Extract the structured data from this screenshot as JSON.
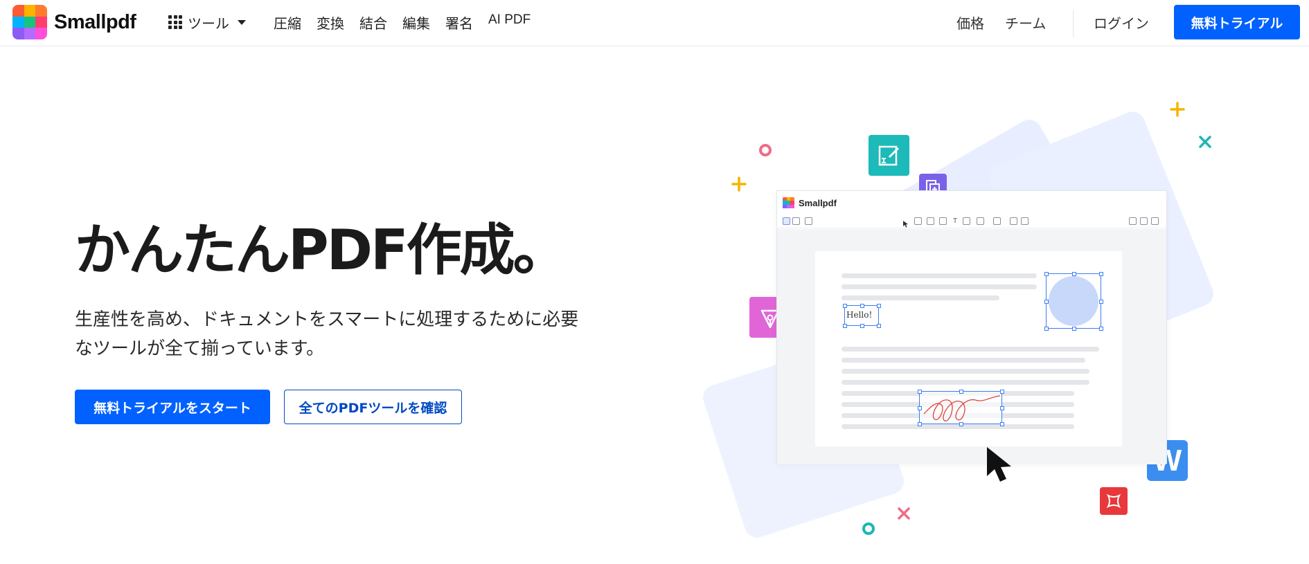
{
  "brand": {
    "name": "Smallpdf",
    "logo_colors": [
      "#ff5a36",
      "#ffb300",
      "#ff7a2f",
      "#00b3ff",
      "#16c47f",
      "#ff3d6e",
      "#8b5cf6",
      "#b26cff",
      "#ff4fd8"
    ]
  },
  "header": {
    "tools_label": "ツール",
    "nav": [
      "圧縮",
      "変換",
      "結合",
      "編集",
      "署名",
      "AI PDF"
    ],
    "pricing": "価格",
    "team": "チーム",
    "login": "ログイン",
    "trial": "無料トライアル"
  },
  "hero": {
    "title": "かんたんPDF作成。",
    "subtitle_line1": "生産性を高め、ドキュメントをスマートに処理するために必要",
    "subtitle_line2": "なツールが全て揃っています。",
    "primary_cta": "無料トライアルをスタート",
    "secondary_cta": "全てのPDFツールを確認"
  },
  "illustration": {
    "editor_name": "Smallpdf",
    "hello_text": "Hello!",
    "word_letter": "W"
  },
  "colors": {
    "accent": "#0061fe",
    "accent_outline": "#0049c2"
  }
}
